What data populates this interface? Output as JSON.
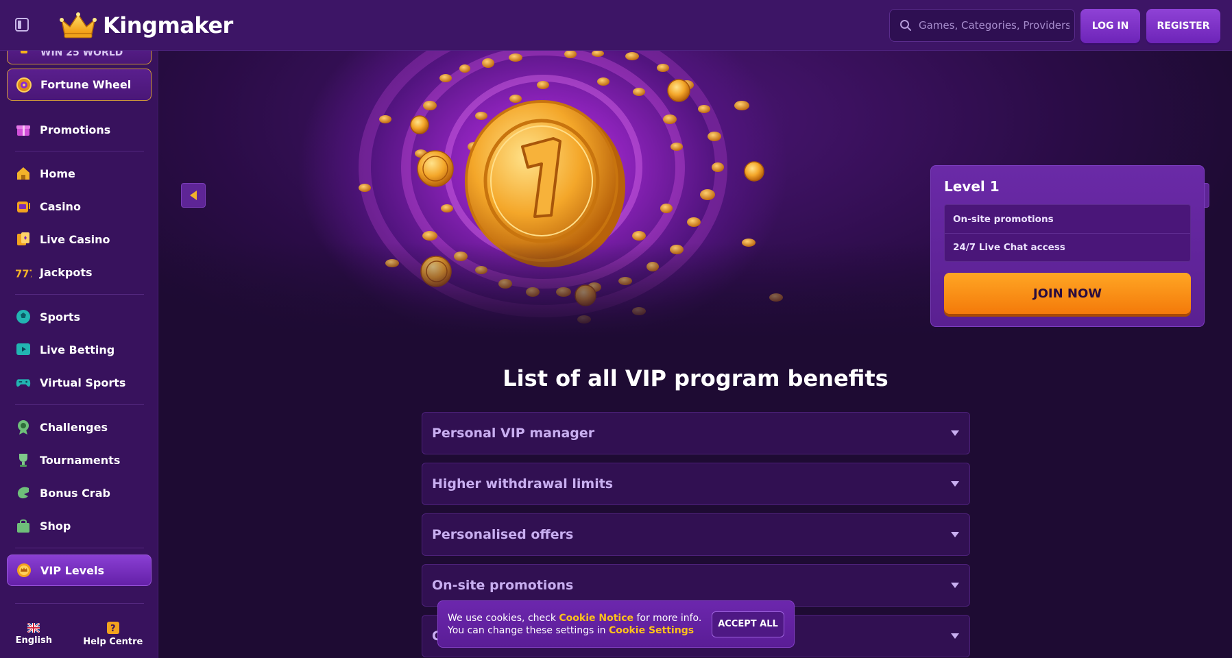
{
  "header": {
    "brand": "Kingmaker",
    "search_placeholder": "Games, Categories, Providers",
    "login_label": "LOG IN",
    "register_label": "REGISTER"
  },
  "sidebar": {
    "top_partial_label": "WIN 25 WORLD",
    "fortune_wheel": "Fortune Wheel",
    "promotions": "Promotions",
    "home": "Home",
    "casino": "Casino",
    "live_casino": "Live Casino",
    "jackpots": "Jackpots",
    "sports": "Sports",
    "live_betting": "Live Betting",
    "virtual_sports": "Virtual Sports",
    "challenges": "Challenges",
    "tournaments": "Tournaments",
    "bonus_crab": "Bonus Crab",
    "shop": "Shop",
    "vip_levels": "VIP Levels",
    "footer": {
      "language": "English",
      "help": "Help Centre"
    }
  },
  "hero": {
    "level_title": "Level 1",
    "perks": [
      "On-site promotions",
      "24/7 Live Chat access"
    ],
    "join_label": "JOIN NOW"
  },
  "benefits": {
    "title": "List of all VIP program benefits",
    "items": [
      "Personal VIP manager",
      "Higher withdrawal limits",
      "Personalised offers",
      "On-site promotions",
      "C"
    ]
  },
  "cookie": {
    "text_1": "We use cookies, check ",
    "link_1": "Cookie Notice",
    "text_2": " for more info. You can change these settings in ",
    "link_2": "Cookie Settings",
    "accept_label": "ACCEPT ALL"
  },
  "colors": {
    "background": "#1e0b33",
    "header": "#3d1566",
    "sidebar": "#38125d",
    "accent_orange": "#f47a0a",
    "link_yellow": "#ffc21a"
  }
}
